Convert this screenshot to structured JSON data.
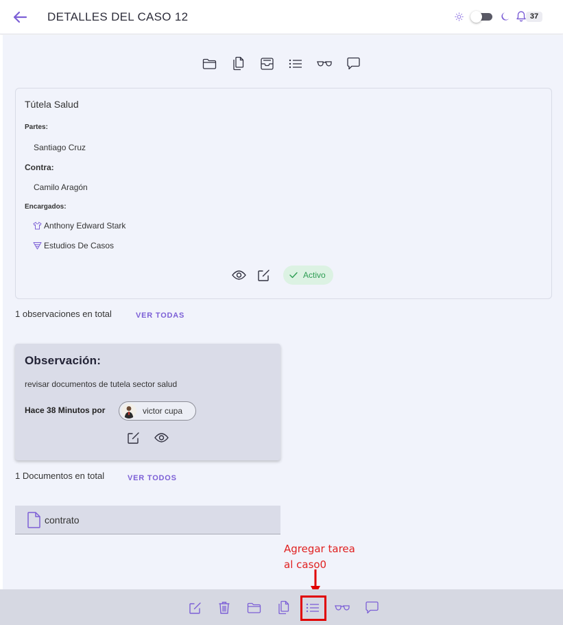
{
  "header": {
    "title": "DETALLES DEL CASO 12",
    "notifications_count": "37",
    "back_icon": "arrow-left-icon",
    "theme_toggle_on": false
  },
  "top_actions": [
    "folder-icon",
    "documents-icon",
    "inbox-icon",
    "task-list-icon",
    "glasses-icon",
    "comment-icon"
  ],
  "case": {
    "title": "Tútela Salud",
    "partes_label": "Partes:",
    "partes_value": "Santiago Cruz",
    "contra_label": "Contra:",
    "contra_value": "Camilo Aragón",
    "encargados_label": "Encargados:",
    "encargados": [
      {
        "name": "Anthony Edward Stark",
        "icon": "shirt-icon"
      },
      {
        "name": "Estudios De Casos",
        "icon": "layers-icon"
      }
    ],
    "status": "Activo"
  },
  "observations": {
    "summary": "1 observaciones en total",
    "link": "VER TODAS",
    "card": {
      "title": "Observación:",
      "text": "revisar documentos de tutela sector salud",
      "meta": "Hace 38 Minutos por",
      "user": "victor cupa"
    }
  },
  "documents": {
    "summary": "1 Documentos en total",
    "link": "VER TODOS",
    "items": [
      {
        "name": "contrato"
      }
    ]
  },
  "annotation": {
    "text": "Agregar tarea\nal caso0"
  },
  "bottom_actions": [
    "edit-icon",
    "trash-icon",
    "folder-icon",
    "documents-icon",
    "task-list-icon",
    "glasses-icon",
    "comment-icon"
  ],
  "colors": {
    "accent": "#7c5fd6",
    "background": "#f1f3fb",
    "card": "#dadce8",
    "status_bg": "#dcf2e3",
    "status_text": "#2c9c52",
    "annotation": "#e02020"
  }
}
